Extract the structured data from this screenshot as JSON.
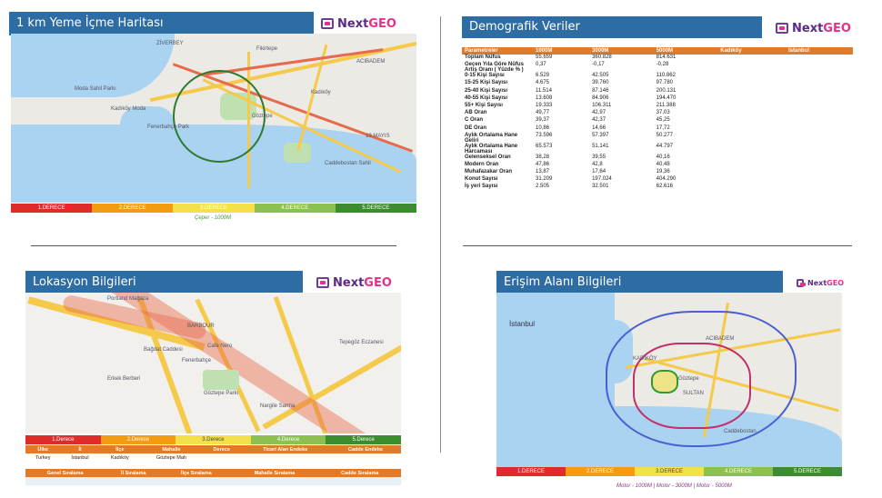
{
  "panels": {
    "food_map": {
      "title": "1 km Yeme İçme Haritası",
      "legend": [
        "1.DERECE",
        "2.DERECE",
        "3.DERECE",
        "4.DERECE",
        "5.DERECE"
      ],
      "caption": "Çeper - 1000M",
      "map_labels": [
        "ZİVERBEY",
        "Moda Sahil Parkı",
        "Kadıköy Moda",
        "Fenerbahçe Park",
        "Caddebostan Sahil",
        "Göztepe",
        "ACIBADEM",
        "Kadıköy",
        "19 MAYIS",
        "Fikirtepe"
      ]
    },
    "demographics": {
      "title": "Demografik Veriler",
      "columns": [
        "Parametreler",
        "1000M",
        "3000M",
        "5000M",
        "Kadıköy",
        "İstanbul"
      ],
      "rows": [
        [
          "Toplam Nüfus",
          "55.659",
          "360.828",
          "814.631",
          "",
          ""
        ],
        [
          "Geçen Yıla Göre Nüfus Artış Oranı ( Yüzde % )",
          "0,37",
          "-0,17",
          "-0,28",
          "",
          ""
        ],
        [
          "0-15 Kişi Sayısı",
          "6.529",
          "42.505",
          "110.862",
          "",
          ""
        ],
        [
          "15-25 Kişi Sayısı",
          "4.675",
          "39.760",
          "97.780",
          "",
          ""
        ],
        [
          "25-40 Kişi Sayısı",
          "11.514",
          "87.146",
          "200.131",
          "",
          ""
        ],
        [
          "40-55 Kişi Sayısı",
          "13.608",
          "84.906",
          "194.470",
          "",
          ""
        ],
        [
          "55+ Kişi Sayısı",
          "19.333",
          "106.311",
          "211.388",
          "",
          ""
        ],
        [
          "AB Oran",
          "49,77",
          "42,97",
          "37,03",
          "",
          ""
        ],
        [
          "C Oran",
          "39,37",
          "42,37",
          "45,25",
          "",
          ""
        ],
        [
          "DE Oran",
          "10,86",
          "14,66",
          "17,72",
          "",
          ""
        ],
        [
          "Aylık Ortalama Hane Geliri",
          "73.596",
          "57.397",
          "50.277",
          "",
          ""
        ],
        [
          "Aylık Ortalama Hane Harcaması",
          "65.573",
          "51.141",
          "44.797",
          "",
          ""
        ],
        [
          "Gelenseksel Oran",
          "38,28",
          "39,55",
          "40,16",
          "",
          ""
        ],
        [
          "Modern Oran",
          "47,86",
          "42,8",
          "40,48",
          "",
          ""
        ],
        [
          "Muhafazakar Oran",
          "13,87",
          "17,64",
          "19,36",
          "",
          ""
        ],
        [
          "Konut Sayısı",
          "31.209",
          "197.024",
          "404.290",
          "",
          ""
        ],
        [
          "İş yeri Sayısı",
          "2.505",
          "32.501",
          "62.616",
          "",
          ""
        ]
      ]
    },
    "location": {
      "title": "Lokasyon Bilgileri",
      "legend": [
        "1.Derece",
        "2.Derece",
        "3.Derece",
        "4.Derece",
        "5.Derece"
      ],
      "table_headers": [
        "Ülke",
        "İl",
        "İlçe",
        "Mahalle",
        "Derece",
        "Ticari Alan Endeks",
        "Cadde Endeks"
      ],
      "table_row": [
        "Turkey",
        "İstanbul",
        "Kadıköy",
        "Göztepe Mah",
        "",
        "",
        ""
      ],
      "rank_headers": [
        "Genel Sıralama",
        "İl Sıralama",
        "İlçe Sıralama",
        "Mahalle Sıralama",
        "Cadde Sıralama"
      ],
      "map_labels": [
        "Portland Mağaza",
        "BARBOUR",
        "Fenerbahçe",
        "Bağdat Caddesi",
        "Göztepe Parkı",
        "Nargile Sarma",
        "Cafe Nero",
        "Erkek Berberi",
        "Tepegöz Eczanesi"
      ]
    },
    "access": {
      "title": "Erişim Alanı Bilgileri",
      "legend": [
        "1.DERECE",
        "2.DERECE",
        "3.DERECE",
        "4.DERECE",
        "5.DERECE"
      ],
      "caption": "Motor - 1000M | Motor - 3000M | Motor - 5000M",
      "map_labels": [
        "İstanbul",
        "KADIKÖY",
        "Göztepe",
        "SULTAN",
        "ACIBADEM",
        "Caddebostan"
      ]
    }
  },
  "brand": {
    "name_a": "Next",
    "name_b": "GEO"
  },
  "colors": {
    "header_blue": "#2e6ca4",
    "table_orange": "#e07b2b",
    "legend": [
      "#e02b2b",
      "#f39c12",
      "#f4e14a",
      "#8cc152",
      "#3c8d2f"
    ]
  }
}
